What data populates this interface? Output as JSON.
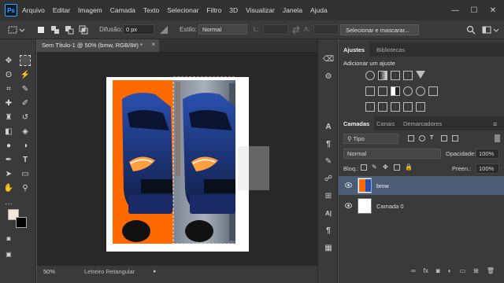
{
  "app": {
    "logo": "Ps"
  },
  "menu": [
    "Arquivo",
    "Editar",
    "Imagem",
    "Camada",
    "Texto",
    "Selecionar",
    "Filtro",
    "3D",
    "Visualizar",
    "Janela",
    "Ajuda"
  ],
  "window_controls": {
    "minimize": "—",
    "maximize": "☐",
    "close": "✕"
  },
  "options": {
    "feather_label": "Difusão:",
    "feather_value": "0 px",
    "style_label": "Estilo:",
    "style_value": "Normal",
    "width_label": "L:",
    "height_label": "A:",
    "select_mask_button": "Selecionar e mascarar..."
  },
  "document": {
    "tab_title": "Sem Título-1 @ 50% (bmw, RGB/8#) *",
    "close": "×",
    "zoom": "50%",
    "status_tool": "Letreiro Retangular",
    "canvas_bg_color": "#ff6a00"
  },
  "adjustments_panel": {
    "tabs": [
      "Ajustes",
      "Bibliotecas"
    ],
    "heading": "Adicionar um ajuste"
  },
  "layers_panel": {
    "tabs": [
      "Camadas",
      "Canais",
      "Demarcadores"
    ],
    "filter_kind": "Tipo",
    "blend_mode": "Normal",
    "opacity_label": "Opacidade:",
    "opacity_value": "100%",
    "lock_label": "Bloq.:",
    "fill_label": "Preen.:",
    "fill_value": "100%",
    "layers": [
      {
        "name": "bmw",
        "selected": true
      },
      {
        "name": "Camada 0",
        "selected": false
      }
    ],
    "footer_icons": [
      "link-icon",
      "fx-icon",
      "mask-icon",
      "adjustment-icon",
      "folder-icon",
      "new-layer-icon",
      "trash-icon"
    ],
    "footer_fx": "fx"
  },
  "colors": {
    "accent": "#31a8ff",
    "orange": "#ff6a00",
    "selected_layer": "#4b5d75"
  }
}
